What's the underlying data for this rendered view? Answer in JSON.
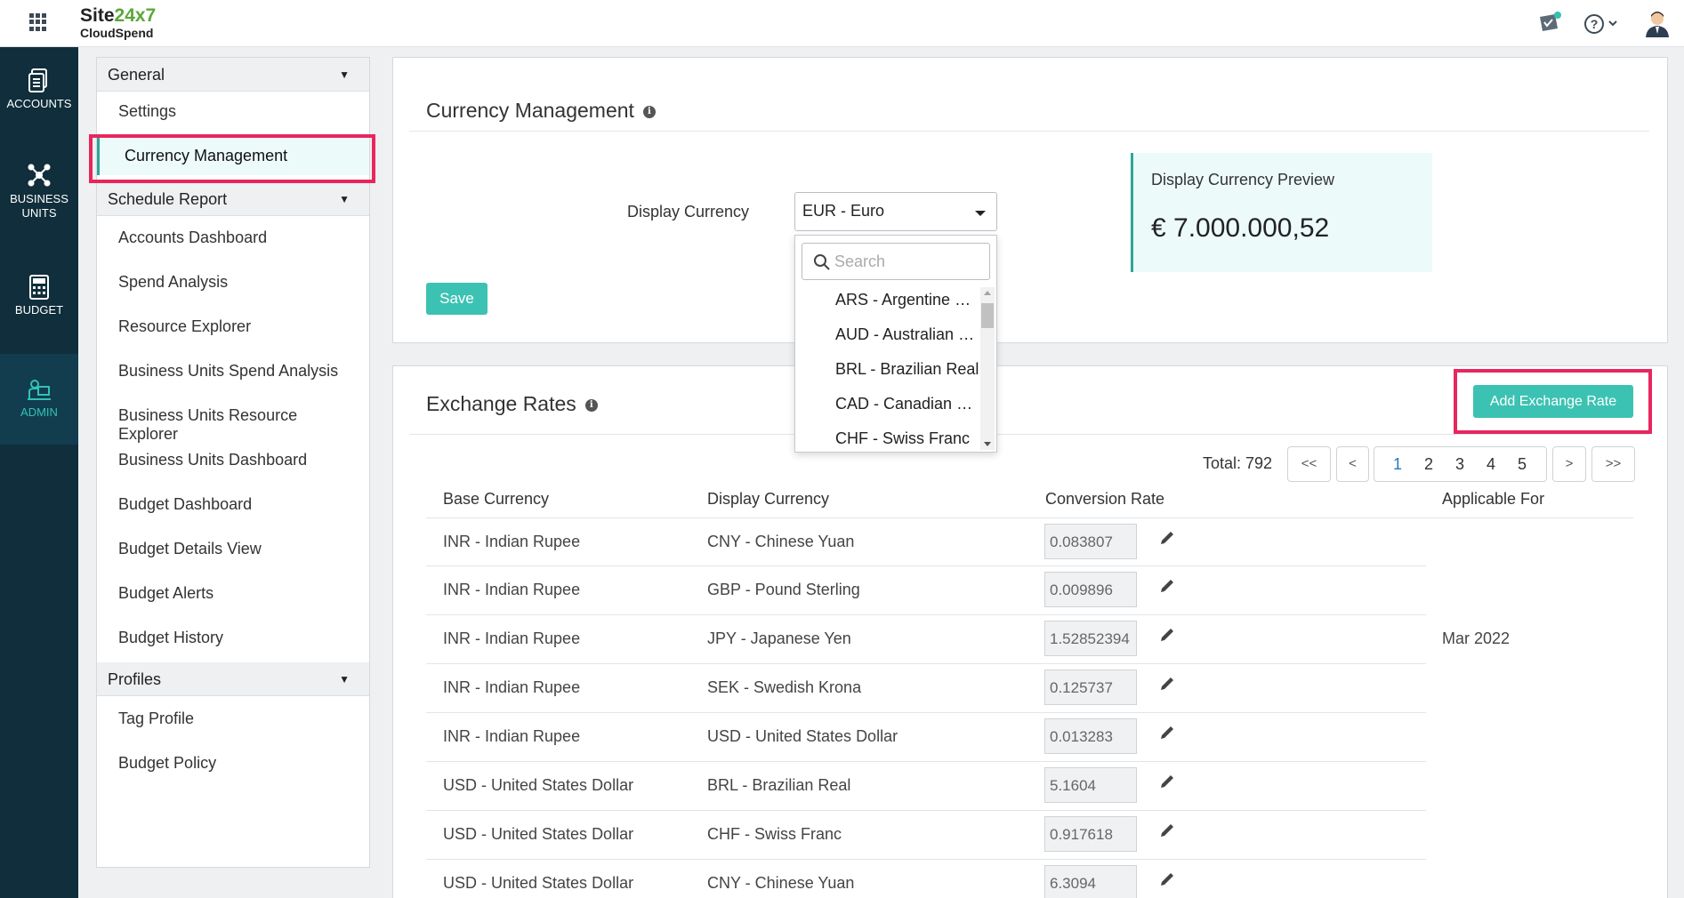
{
  "app": {
    "brand_main": "Site",
    "brand_accent": "24x7",
    "brand_sub": "CloudSpend"
  },
  "header_icons": [
    "apps-grid-icon",
    "notification-icon",
    "help-icon",
    "user-avatar-icon"
  ],
  "rail": {
    "accounts": "ACCOUNTS",
    "business_units_1": "BUSINESS",
    "business_units_2": "UNITS",
    "budget": "BUDGET",
    "admin": "ADMIN"
  },
  "sidebar": {
    "general": "General",
    "settings": "Settings",
    "currency_management": "Currency Management",
    "schedule_report": "Schedule Report",
    "accounts_dashboard": "Accounts Dashboard",
    "spend_analysis": "Spend Analysis",
    "resource_explorer": "Resource Explorer",
    "bu_spend_analysis": "Business Units Spend Analysis",
    "bu_resource_explorer": "Business Units Resource Explorer",
    "bu_dashboard": "Business Units Dashboard",
    "budget_dashboard": "Budget Dashboard",
    "budget_details_view": "Budget Details View",
    "budget_alerts": "Budget Alerts",
    "budget_history": "Budget History",
    "profiles": "Profiles",
    "tag_profile": "Tag Profile",
    "budget_policy": "Budget Policy"
  },
  "currency": {
    "title": "Currency Management",
    "display_currency_label": "Display Currency",
    "display_currency_value": "EUR - Euro",
    "save": "Save",
    "preview_title": "Display Currency Preview",
    "preview_value": "€ 7.000.000,52"
  },
  "dropdown": {
    "search_placeholder": "Search",
    "options": [
      "ARS - Argentine Peso",
      "AUD - Australian Dollar",
      "BRL - Brazilian Real",
      "CAD - Canadian Dollar",
      "CHF - Swiss Franc"
    ]
  },
  "exchange": {
    "title": "Exchange Rates",
    "add_button": "Add Exchange Rate",
    "total": "Total: 792",
    "pager": {
      "first": "<<",
      "prev": "<",
      "next": ">",
      "last": ">>",
      "pages": [
        "1",
        "2",
        "3",
        "4",
        "5"
      ],
      "current": "1"
    },
    "columns": [
      "Base Currency",
      "Display Currency",
      "Conversion Rate",
      "Applicable For"
    ],
    "applicable_for": "Mar 2022",
    "rows": [
      {
        "base": "INR - Indian Rupee",
        "display": "CNY - Chinese Yuan",
        "rate": "0.083807"
      },
      {
        "base": "INR - Indian Rupee",
        "display": "GBP - Pound Sterling",
        "rate": "0.009896"
      },
      {
        "base": "INR - Indian Rupee",
        "display": "JPY - Japanese Yen",
        "rate": "1.52852394"
      },
      {
        "base": "INR - Indian Rupee",
        "display": "SEK - Swedish Krona",
        "rate": "0.125737"
      },
      {
        "base": "INR - Indian Rupee",
        "display": "USD - United States Dollar",
        "rate": "0.013283"
      },
      {
        "base": "USD - United States Dollar",
        "display": "BRL - Brazilian Real",
        "rate": "5.1604"
      },
      {
        "base": "USD - United States Dollar",
        "display": "CHF - Swiss Franc",
        "rate": "0.917618"
      },
      {
        "base": "USD - United States Dollar",
        "display": "CNY - Chinese Yuan",
        "rate": "6.3094"
      }
    ]
  }
}
